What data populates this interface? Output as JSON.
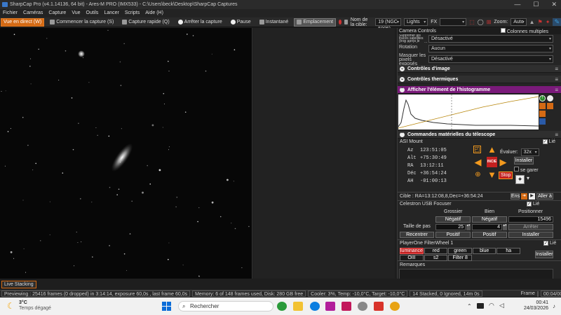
{
  "window": {
    "title": "SharpCap Pro (v4.1.14136, 64 bit) - Ares-M PRO (IMX533) - C:\\Users\\beck\\Desktop\\SharpCap Captures",
    "buttons": [
      "—",
      "☐",
      "✕"
    ]
  },
  "menu": [
    "Fichier",
    "Caméras",
    "Capture",
    "Vue",
    "Outils",
    "Lancer",
    "Scripts",
    "Aide (H)"
  ],
  "toolbar": {
    "live_view": "Vue en direct (W)",
    "start_capture": "Commencer la capture (S)",
    "quick_capture": "Capture rapide (Q)",
    "stop_capture": "Arrêter la capture",
    "pause": "Pause",
    "snapshot": "Instantané",
    "placement": "Emplacement",
    "target_label": "Nom de la cible:",
    "target_value": "19 (NGC 5005)",
    "frame_type": "Lights",
    "fx_label": "FX",
    "zoom_label": "Zoom:",
    "zoom_value": "Auto"
  },
  "camera_controls": {
    "title": "Camera Controls",
    "multicolumn": "Colonnes multiples",
    "rows": [
      {
        "label": "Supprimer les traces satellites (trop après le tombée de la nuit/à réalt",
        "value": "Désactivé"
      },
      {
        "label": "Rotation",
        "value": "Aucun"
      },
      {
        "label": "Masquer les pixels exposés",
        "value": "Désactivé"
      }
    ]
  },
  "sections": {
    "image_controls": "Contrôles d'image",
    "thermal_controls": "Contrôles thermiques",
    "histogram": "Afficher l'élément de l'histogramme",
    "hardware": "Commandes matérielles du télescope"
  },
  "mount": {
    "name": "ASI Mount",
    "connected_label": "Lié",
    "az_label": "Az",
    "az": "123:51:05",
    "alt_label": "Alt",
    "alt": "+75:30:49",
    "ra_label": "RA",
    "ra": "13:12:11",
    "dec_label": "Déc",
    "dec": "+36:54:24",
    "ha_label": "AH",
    "ha": "-01:00:13",
    "rate_label": "Évaluer:",
    "rate_value": "32x",
    "install": "Installer",
    "park_label": "se garer",
    "center_label": "INCIE",
    "stop_button": "Stop",
    "target": "Cible : RA=13:12:08,8,Dec=+36:54:24",
    "go_button": "Aller à",
    "en_button": "Ens"
  },
  "focuser": {
    "name": "Celestron USB Focuser",
    "connected_label": "Lié",
    "col_coarse": "Grossier",
    "col_fine": "Bien",
    "col_position": "Positionner",
    "neg": "Négatif",
    "pos": "Positif",
    "position_value": "15496",
    "step_label": "Taille de pas",
    "coarse_step": "25",
    "fine_step": "4",
    "stop": "Arrêter",
    "install": "Installer",
    "recenter": "Recentrer"
  },
  "filterwheel": {
    "name": "PlayerOne FilterWheel 1",
    "connected_label": "Lié",
    "filters": [
      "luminance",
      "red",
      "green",
      "blue",
      "ha",
      "OIII",
      "s2",
      "Filter 8"
    ],
    "selected": "luminance",
    "install": "Installer"
  },
  "remarks_label": "Remarques",
  "live_stacking": "Live Stacking",
  "status": {
    "previewing": "Previewing : 25416 frames (0 dropped) in 3:14:14, exposure 60,0s , last frame 60,0s",
    "memory": "Memory: 6 of 148 frames used, Disk: 280 GB free",
    "cooler": "Cooler: 3%, Temp: -10,0°C, Target: -10,0°C",
    "stacked": "14 Stacked, 0 Ignored, 14m 0s",
    "frame_label": "Frame",
    "time": "00:04/00:56"
  },
  "taskbar": {
    "weather_temp": "3°C",
    "weather_desc": "Temps dégagé",
    "search_placeholder": "Rechercher",
    "clock_time": "00:41",
    "clock_date": "24/03/2026"
  }
}
